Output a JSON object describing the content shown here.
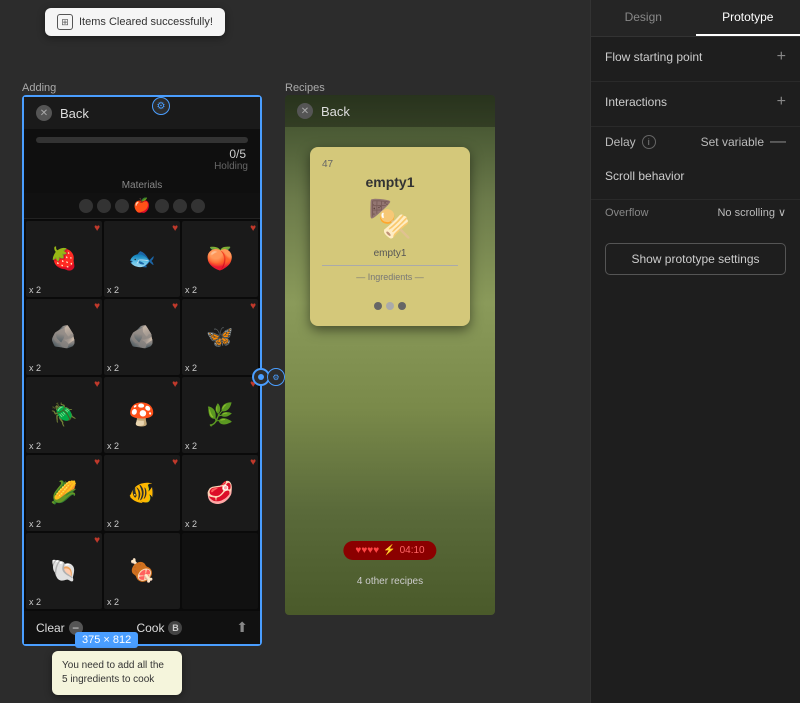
{
  "tabs": {
    "design": "Design",
    "prototype": "Prototype",
    "active": "prototype"
  },
  "right_panel": {
    "flow_starting_point": {
      "title": "Flow starting point",
      "plus": "+"
    },
    "interactions": {
      "title": "Interactions",
      "plus": "+",
      "delay_label": "Delay",
      "set_variable_label": "Set variable",
      "minus": "—"
    },
    "scroll_behavior": {
      "title": "Scroll behavior",
      "overflow_label": "Overflow",
      "overflow_value": "No scrolling",
      "dropdown_arrow": "∨"
    },
    "prototype_btn": "Show prototype settings"
  },
  "canvas": {
    "adding_label": "Adding",
    "recipes_label": "Recipes",
    "toast": "Items Cleared successfully!",
    "dimension": "375 × 812",
    "tooltip": "You need to add all the 5 ingredients to cook",
    "back_text": "Back",
    "materials_label": "Materials",
    "holding_count": "0/5",
    "holding_label": "Holding",
    "clear_text": "Clear",
    "cook_text": "Cook",
    "recipe_number": "47",
    "recipe_name": "empty1",
    "recipe_subname": "empty1",
    "ingredients_label": "— Ingredients —",
    "timer": "04:10",
    "other_recipes": "4 other recipes"
  },
  "grid_items": [
    {
      "emoji": "🍓",
      "count": "x 2",
      "heart": true
    },
    {
      "emoji": "🐟",
      "count": "x 2",
      "heart": true
    },
    {
      "emoji": "🍑",
      "count": "x 2",
      "heart": true
    },
    {
      "emoji": "🪨",
      "count": "x 2",
      "heart": true
    },
    {
      "emoji": "🪨",
      "count": "x 2",
      "heart": true
    },
    {
      "emoji": "🦋",
      "count": "x 2",
      "heart": true
    },
    {
      "emoji": "🪲",
      "count": "x 2",
      "heart": true
    },
    {
      "emoji": "🍄",
      "count": "x 2",
      "heart": true
    },
    {
      "emoji": "🌿",
      "count": "x 2",
      "heart": true
    },
    {
      "emoji": "🌽",
      "count": "x 2",
      "heart": true
    },
    {
      "emoji": "🐠",
      "count": "x 2",
      "heart": true
    },
    {
      "emoji": "🥩",
      "count": "x 2",
      "heart": true
    },
    {
      "emoji": "🐚",
      "count": "x 2",
      "heart": true
    },
    {
      "emoji": "🍖",
      "count": "x 2",
      "heart": true
    },
    {
      "emoji": "",
      "count": "",
      "heart": false
    }
  ]
}
